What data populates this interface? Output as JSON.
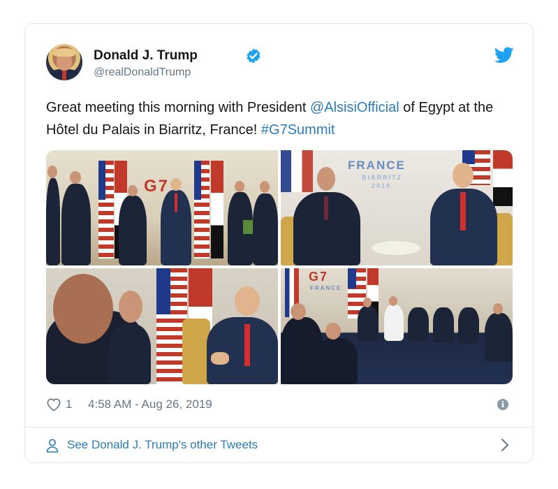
{
  "tweet": {
    "author_name": "Donald J. Trump",
    "author_handle": "@realDonaldTrump",
    "text_before": "Great meeting this morning with President ",
    "mention": "@AlsisiOfficial",
    "text_after": " of Egypt at the Hôtel du Palais in Biarritz, France! ",
    "hashtag": "#G7Summit",
    "like_count": "1",
    "timestamp": "4:58 AM - Aug 26, 2019",
    "more_tweets_label": "See Donald J. Trump's other Tweets"
  },
  "media": {
    "photo2_backdrop_word": "FRANCE",
    "photo2_backdrop_city": "BIARRITZ",
    "photo2_backdrop_year": "2019",
    "photo4_backdrop_word": "FRANCE"
  },
  "colors": {
    "link": "#2b7bb9",
    "text": "#14171a",
    "muted": "#657786",
    "border": "#e1e8ed",
    "twitter_blue": "#1da1f2"
  },
  "icons": [
    "avatar",
    "verified-badge-icon",
    "twitter-bird-icon",
    "heart-icon",
    "info-icon",
    "person-icon",
    "chevron-right-icon"
  ]
}
